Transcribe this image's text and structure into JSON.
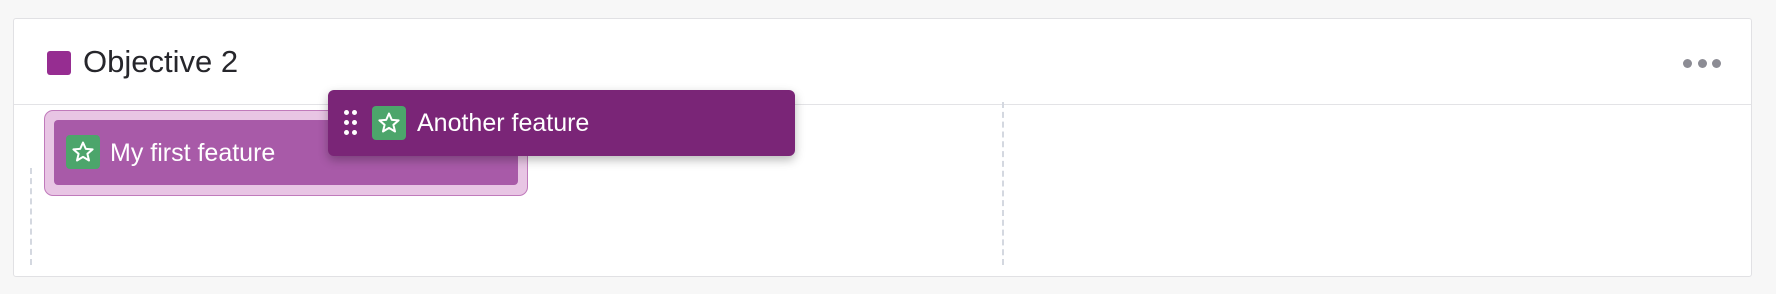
{
  "objective": {
    "title": "Objective 2",
    "color": "#962d91",
    "more_icon": "more-horizontal-icon"
  },
  "features": [
    {
      "label": "My first feature",
      "icon": "star-icon",
      "icon_bg": "#4ca56b",
      "card_color": "#a85aa8"
    }
  ],
  "dragged_feature": {
    "label": "Another feature",
    "icon": "star-icon",
    "handle_icon": "drag-handle-icon",
    "icon_bg": "#4ca56b",
    "card_color": "#7a2577"
  }
}
